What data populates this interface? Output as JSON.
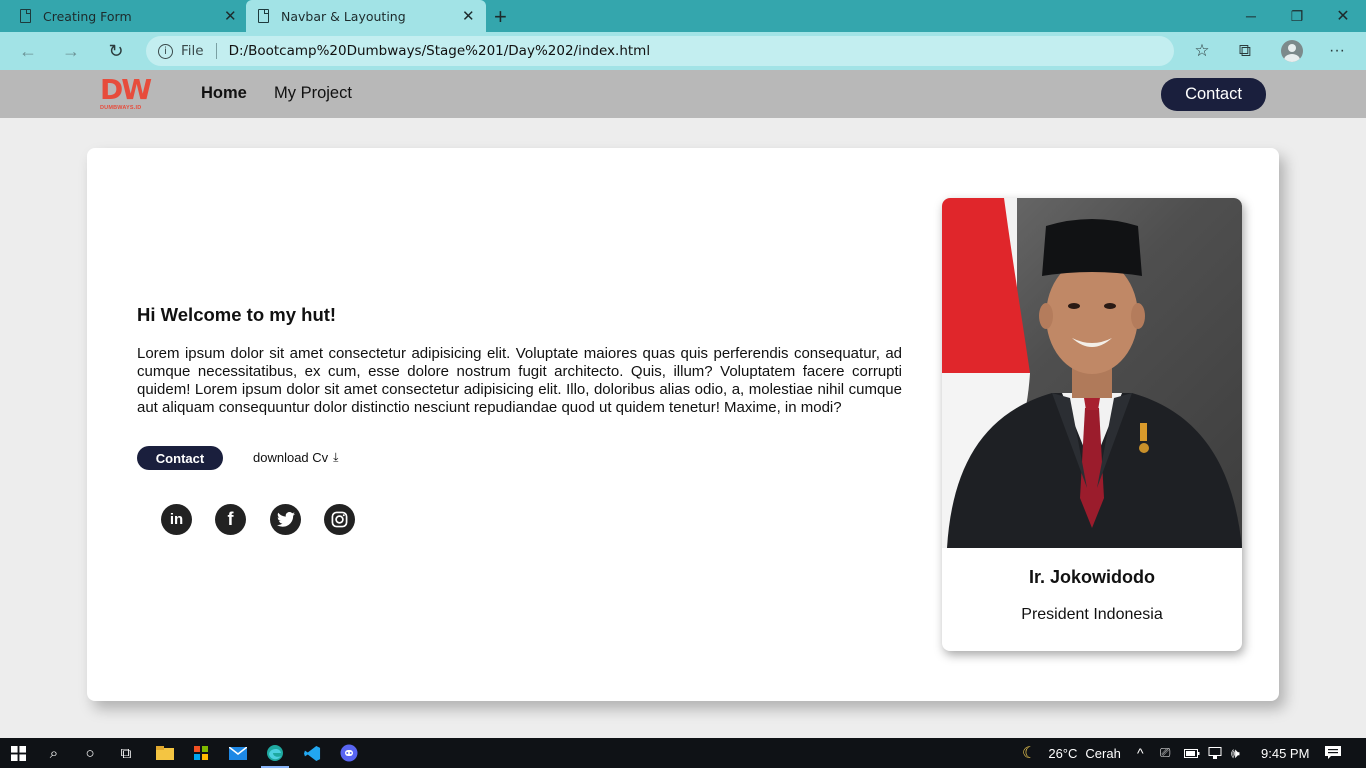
{
  "browser": {
    "tabs": [
      {
        "title": "Creating Form",
        "active": false
      },
      {
        "title": "Navbar & Layouting",
        "active": true
      }
    ],
    "address": {
      "scheme_label": "File",
      "url": "D:/Bootcamp%20Dumbways/Stage%201/Day%202/index.html"
    }
  },
  "site": {
    "logo": {
      "mark": "DW",
      "text": "DUMBWAYS.ID"
    },
    "nav": {
      "home": "Home",
      "project": "My Project",
      "contact": "Contact"
    },
    "hero": {
      "heading": "Hi Welcome to my hut!",
      "paragraph": "Lorem ipsum dolor sit amet consectetur adipisicing elit. Voluptate maiores quas quis perferendis consequatur, ad cumque necessitatibus, ex cum, esse dolore nostrum fugit architecto. Quis, illum? Voluptatem facere corrupti quidem! Lorem ipsum dolor sit amet consectetur adipisicing elit. Illo, doloribus alias odio, a, molestiae nihil cumque aut aliquam consequuntur dolor distinctio nesciunt repudiandae quod ut quidem tenetur! Maxime, in modi?",
      "contact_button": "Contact",
      "download_label": "download Cv",
      "socials": [
        "linkedin-icon",
        "facebook-icon",
        "twitter-icon",
        "instagram-icon"
      ]
    },
    "profile": {
      "name": "Ir. Jokowidodo",
      "title": "President Indonesia"
    }
  },
  "taskbar": {
    "weather": {
      "temp": "26°C",
      "condition": "Cerah"
    },
    "time": "9:45 PM"
  },
  "colors": {
    "tabbar": "#34a6ad",
    "addressbar": "#a2e3e6",
    "navbar": "#b8b8b8",
    "brand": "#e74c3c",
    "button": "#1a1f3d"
  }
}
